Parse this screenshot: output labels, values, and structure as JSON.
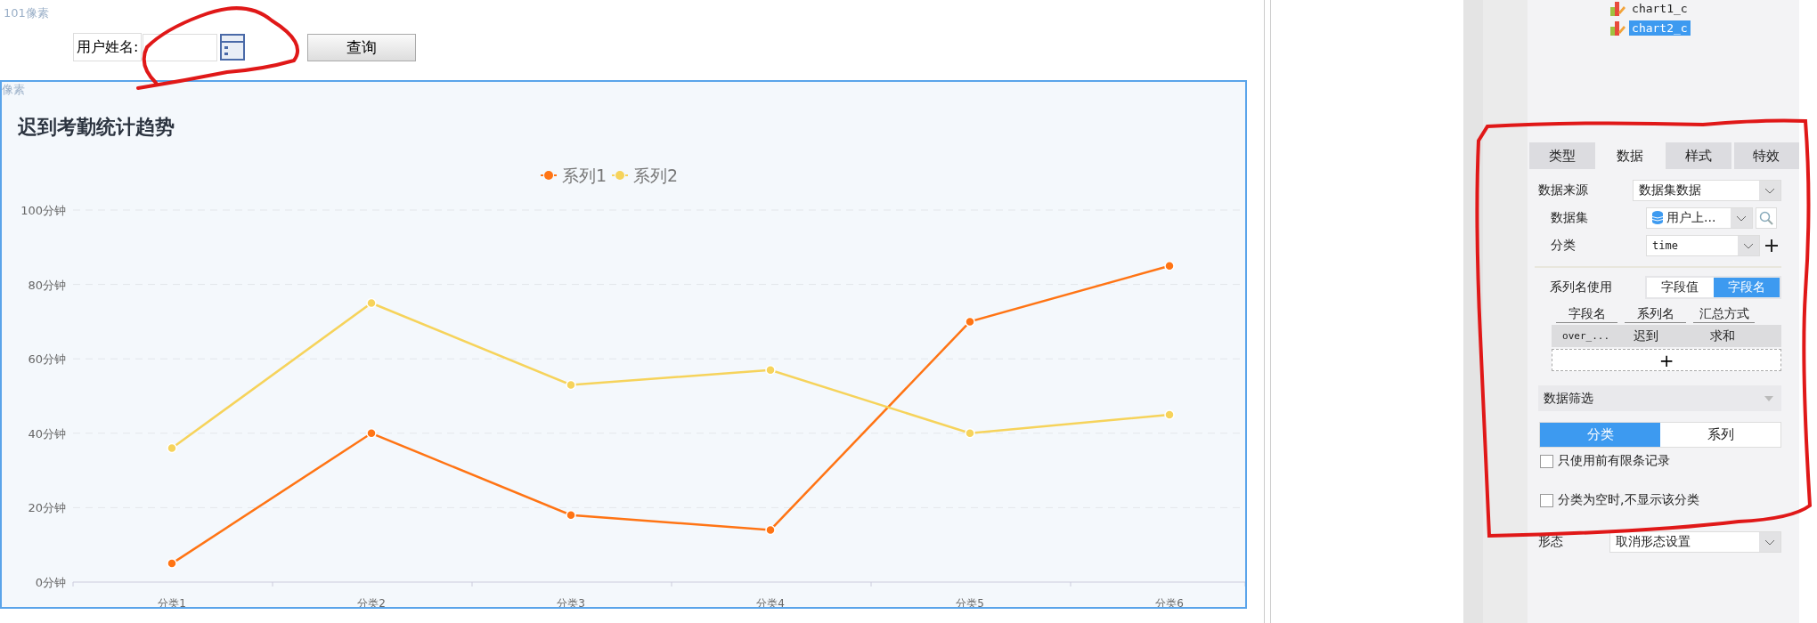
{
  "designer": {
    "top_margin_label": "101像素",
    "form": {
      "label": "用户姓名:",
      "query_button": "查询",
      "circled": true
    },
    "chart_margin_label": "像素",
    "chart": {
      "chart_data": {
        "type": "line",
        "title": "迟到考勤统计趋势",
        "categories": [
          "分类1",
          "分类2",
          "分类3",
          "分类4",
          "分类5",
          "分类6"
        ],
        "series": [
          {
            "name": "系列1",
            "color": "#ff7414",
            "marker": "circle",
            "values": [
              5,
              40,
              18,
              14,
              70,
              85
            ]
          },
          {
            "name": "系列2",
            "color": "#f6d35b",
            "marker": "circle",
            "values": [
              36,
              75,
              53,
              57,
              40,
              45
            ]
          }
        ],
        "grid": true,
        "legend": "top",
        "ylim": [
          0,
          100
        ],
        "yticks": [
          {
            "value": 0,
            "label": "0分钟"
          },
          {
            "value": 20,
            "label": "20分钟"
          },
          {
            "value": 40,
            "label": "40分钟"
          },
          {
            "value": 60,
            "label": "60分钟"
          },
          {
            "value": 80,
            "label": "80分钟"
          },
          {
            "value": 100,
            "label": "100分钟"
          }
        ]
      }
    }
  },
  "tree": {
    "items": [
      {
        "label": "chart1_c",
        "selected": false
      },
      {
        "label": "chart2_c",
        "selected": true
      }
    ]
  },
  "panel": {
    "tabs": [
      {
        "label": "类型",
        "selected": false
      },
      {
        "label": "数据",
        "selected": true
      },
      {
        "label": "样式",
        "selected": false
      },
      {
        "label": "特效",
        "selected": false
      }
    ],
    "data_source": {
      "label": "数据来源",
      "value": "数据集数据"
    },
    "dataset": {
      "label": "数据集",
      "value": "用户上..."
    },
    "category": {
      "label": "分类",
      "value": "time"
    },
    "series_name": {
      "label": "系列名使用",
      "options": [
        {
          "label": "字段值",
          "selected": false
        },
        {
          "label": "字段名",
          "selected": true
        }
      ]
    },
    "table": {
      "columns": [
        "字段名",
        "系列名",
        "汇总方式"
      ],
      "rows": [
        [
          "over_...",
          "迟到",
          "求和"
        ]
      ],
      "add": "+"
    },
    "filter": {
      "title": "数据筛选",
      "expanded": true,
      "segments": [
        {
          "label": "分类",
          "selected": true
        },
        {
          "label": "系列",
          "selected": false
        }
      ],
      "checks": [
        {
          "label": "只使用前有限条记录",
          "checked": false
        },
        {
          "label": "分类为空时,不显示该分类",
          "checked": false
        }
      ]
    },
    "shape": {
      "label": "形态",
      "value": "取消形态设置"
    },
    "circled": true
  }
}
